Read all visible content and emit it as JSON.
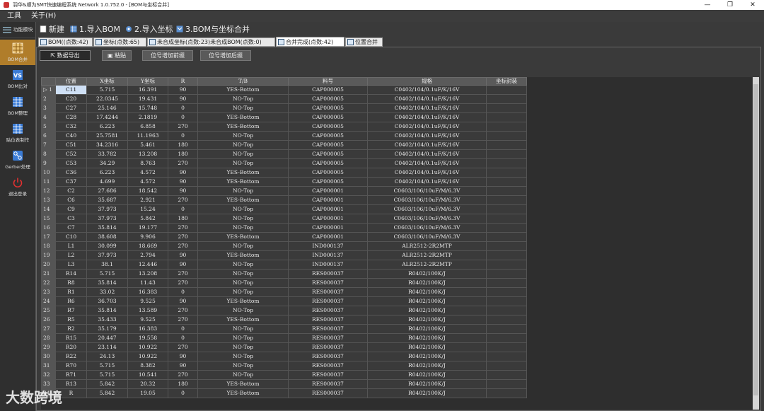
{
  "window": {
    "title": "羽华&顺为SMT快速编程系统 Network   1.0.752.0 - [BOM与坐标合并]",
    "min": "—",
    "restore": "❐",
    "close": "✕"
  },
  "menu": [
    "工具",
    "关于(H)"
  ],
  "sidebar": {
    "module_label": "功能模块",
    "items": [
      {
        "label": "BOM合并",
        "icon": "grid-icon",
        "active": true
      },
      {
        "label": "BOM比对",
        "icon": "vs-icon",
        "active": false
      },
      {
        "label": "BOM整理",
        "icon": "table-icon",
        "active": false
      },
      {
        "label": "贴位表制作",
        "icon": "table-icon",
        "active": false
      },
      {
        "label": "Gerber处理",
        "icon": "gerber-icon",
        "active": false
      },
      {
        "label": "退出登录",
        "icon": "power-icon",
        "active": false
      }
    ]
  },
  "toolbar": {
    "new_label": "新建",
    "import_bom_label": "1.导入BOM",
    "import_coord_label": "2.导入坐标",
    "merge_label": "3.BOM与坐标合并"
  },
  "tabs": [
    {
      "label": "BOM((点数:42)",
      "active": false
    },
    {
      "label": "坐标(点数:65)",
      "active": false
    },
    {
      "label": "未合成坐标(点数:23)未合成BOM(点数:0)",
      "active": false
    },
    {
      "label": "合并完成(点数:42)",
      "active": true
    },
    {
      "label": "位置合并",
      "active": false
    }
  ],
  "actions": {
    "export_label": "数据导出",
    "paste_label": "粘贴",
    "prefix_label": "位号增加前缀",
    "suffix_label": "位号增加后缀"
  },
  "table": {
    "headers": [
      "位置",
      "X坐标",
      "Y坐标",
      "R",
      "T/B",
      "料号",
      "规格",
      "坐标封装"
    ],
    "rows": [
      [
        "C11",
        "5.715",
        "16.391",
        "90",
        "YES-Bottom",
        "CAP000005",
        "C0402/104/0.1uF/K/16V",
        ""
      ],
      [
        "C20",
        "22.0345",
        "19.431",
        "90",
        "NO-Top",
        "CAP000005",
        "C0402/104/0.1uF/K/16V",
        ""
      ],
      [
        "C27",
        "25.146",
        "15.748",
        "0",
        "NO-Top",
        "CAP000005",
        "C0402/104/0.1uF/K/16V",
        ""
      ],
      [
        "C28",
        "17.4244",
        "2.1819",
        "0",
        "YES-Bottom",
        "CAP000005",
        "C0402/104/0.1uF/K/16V",
        ""
      ],
      [
        "C32",
        "6.223",
        "6.858",
        "270",
        "YES-Bottom",
        "CAP000005",
        "C0402/104/0.1uF/K/16V",
        ""
      ],
      [
        "C40",
        "25.7581",
        "11.1963",
        "0",
        "NO-Top",
        "CAP000005",
        "C0402/104/0.1uF/K/16V",
        ""
      ],
      [
        "C51",
        "34.2316",
        "5.461",
        "180",
        "NO-Top",
        "CAP000005",
        "C0402/104/0.1uF/K/16V",
        ""
      ],
      [
        "C52",
        "33.782",
        "13.208",
        "180",
        "NO-Top",
        "CAP000005",
        "C0402/104/0.1uF/K/16V",
        ""
      ],
      [
        "C53",
        "34.29",
        "8.763",
        "270",
        "NO-Top",
        "CAP000005",
        "C0402/104/0.1uF/K/16V",
        ""
      ],
      [
        "C36",
        "6.223",
        "4.572",
        "90",
        "YES-Bottom",
        "CAP000005",
        "C0402/104/0.1uF/K/16V",
        ""
      ],
      [
        "C37",
        "4.699",
        "4.572",
        "90",
        "YES-Bottom",
        "CAP000005",
        "C0402/104/0.1uF/K/16V",
        ""
      ],
      [
        "C2",
        "27.686",
        "18.542",
        "90",
        "NO-Top",
        "CAP000001",
        "C0603/106/10uF/M/6.3V",
        ""
      ],
      [
        "C6",
        "35.687",
        "2.921",
        "270",
        "YES-Bottom",
        "CAP000001",
        "C0603/106/10uF/M/6.3V",
        ""
      ],
      [
        "C9",
        "37.973",
        "15.24",
        "0",
        "NO-Top",
        "CAP000001",
        "C0603/106/10uF/M/6.3V",
        ""
      ],
      [
        "C3",
        "37.973",
        "5.842",
        "180",
        "NO-Top",
        "CAP000001",
        "C0603/106/10uF/M/6.3V",
        ""
      ],
      [
        "C7",
        "35.814",
        "19.177",
        "270",
        "NO-Top",
        "CAP000001",
        "C0603/106/10uF/M/6.3V",
        ""
      ],
      [
        "C10",
        "38.608",
        "9.906",
        "270",
        "YES-Bottom",
        "CAP000001",
        "C0603/106/10uF/M/6.3V",
        ""
      ],
      [
        "L1",
        "30.099",
        "18.669",
        "270",
        "NO-Top",
        "IND000137",
        "ALR2512-2R2MTP",
        ""
      ],
      [
        "L2",
        "37.973",
        "2.794",
        "90",
        "YES-Bottom",
        "IND000137",
        "ALR2512-2R2MTP",
        ""
      ],
      [
        "L3",
        "38.1",
        "12.446",
        "90",
        "NO-Top",
        "IND000137",
        "ALR2512-2R2MTP",
        ""
      ],
      [
        "R14",
        "5.715",
        "13.208",
        "270",
        "NO-Top",
        "RES000037",
        "R0402/100K/J",
        ""
      ],
      [
        "R8",
        "35.814",
        "11.43",
        "270",
        "NO-Top",
        "RES000037",
        "R0402/100K/J",
        ""
      ],
      [
        "R1",
        "33.02",
        "16.383",
        "0",
        "NO-Top",
        "RES000037",
        "R0402/100K/J",
        ""
      ],
      [
        "R6",
        "36.703",
        "9.525",
        "90",
        "YES-Bottom",
        "RES000037",
        "R0402/100K/J",
        ""
      ],
      [
        "R7",
        "35.814",
        "13.589",
        "270",
        "NO-Top",
        "RES000037",
        "R0402/100K/J",
        ""
      ],
      [
        "R5",
        "35.433",
        "9.525",
        "270",
        "YES-Bottom",
        "RES000037",
        "R0402/100K/J",
        ""
      ],
      [
        "R2",
        "35.179",
        "16.383",
        "0",
        "NO-Top",
        "RES000037",
        "R0402/100K/J",
        ""
      ],
      [
        "R15",
        "20.447",
        "19.558",
        "0",
        "NO-Top",
        "RES000037",
        "R0402/100K/J",
        ""
      ],
      [
        "R20",
        "23.114",
        "10.922",
        "270",
        "NO-Top",
        "RES000037",
        "R0402/100K/J",
        ""
      ],
      [
        "R22",
        "24.13",
        "10.922",
        "90",
        "NO-Top",
        "RES000037",
        "R0402/100K/J",
        ""
      ],
      [
        "R70",
        "5.715",
        "8.382",
        "90",
        "NO-Top",
        "RES000037",
        "R0402/100K/J",
        ""
      ],
      [
        "R71",
        "5.715",
        "10.541",
        "270",
        "NO-Top",
        "RES000037",
        "R0402/100K/J",
        ""
      ],
      [
        "R13",
        "5.842",
        "20.32",
        "180",
        "YES-Bottom",
        "RES000037",
        "R0402/100K/J",
        ""
      ],
      [
        "R",
        "5.842",
        "19.05",
        "0",
        "YES-Bottom",
        "RES000037",
        "R0402/100K/J",
        ""
      ]
    ]
  },
  "watermark": "大数跨境",
  "colors": {
    "active_nav": "#b07d2a",
    "selected_cell": "#cfe0f5",
    "background": "#3a3a3a"
  }
}
